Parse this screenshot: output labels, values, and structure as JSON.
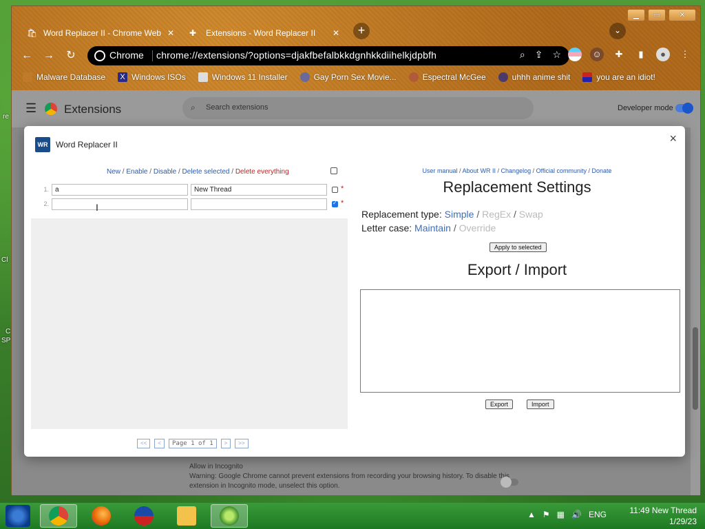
{
  "desktop": {
    "left_fragments": [
      "re",
      "Cl",
      "C",
      "SP"
    ]
  },
  "browser": {
    "tabs": [
      {
        "label": "Word Replacer II - Chrome Web",
        "icon": "webstore-icon"
      },
      {
        "label": "Extensions - Word Replacer II",
        "icon": "puzzle-icon"
      }
    ],
    "new_tab_symbol": "+",
    "omnibox": {
      "site_label": "Chrome",
      "url": "chrome://extensions/?options=djakfbefalbkkdgnhkkdiihelkjdpbfh"
    },
    "bookmarks": [
      {
        "label": "Malware Database",
        "icon": "folder-icon"
      },
      {
        "label": "Windows ISOs",
        "icon": "x-icon"
      },
      {
        "label": "Windows 11 Installer",
        "icon": "installer-icon"
      },
      {
        "label": "Gay Porn Sex Movie...",
        "icon": "site-icon"
      },
      {
        "label": "Espectral McGee",
        "icon": "face-icon"
      },
      {
        "label": "uhhh anime shit",
        "icon": "anime-icon"
      },
      {
        "label": "you are an idiot!",
        "icon": "flag-icon"
      }
    ]
  },
  "extensions_page": {
    "title": "Extensions",
    "search_placeholder": "Search extensions",
    "developer_mode_label": "Developer mode",
    "incognito_title": "Allow in Incognito",
    "incognito_warning": "Warning: Google Chrome cannot prevent extensions from recording your browsing history. To disable this extension in Incognito mode, unselect this option."
  },
  "dialog": {
    "icon_text": "WR",
    "title": "Word Replacer II",
    "close_symbol": "×",
    "actions": {
      "new": "New",
      "enable": "Enable",
      "disable": "Disable",
      "delete_selected": "Delete selected",
      "delete_everything": "Delete everything"
    },
    "rows": [
      {
        "num": "1.",
        "find": "a",
        "replace": "New Thread",
        "checked": false
      },
      {
        "num": "2.",
        "find": "",
        "replace": "",
        "checked": true
      }
    ],
    "required_mark": "*",
    "pager": {
      "first": "<<",
      "prev": "<",
      "label": "Page 1 of 1",
      "next": ">",
      "last": ">>"
    },
    "links": {
      "manual": "User manual",
      "about": "About WR II",
      "changelog": "Changelog",
      "community": "Official community",
      "donate": "Donate"
    },
    "settings_heading": "Replacement Settings",
    "replacement_type": {
      "label": "Replacement type:",
      "simple": "Simple",
      "regex": "RegEx",
      "swap": "Swap"
    },
    "letter_case": {
      "label": "Letter case:",
      "maintain": "Maintain",
      "override": "Override"
    },
    "apply_button": "Apply to selected",
    "export_heading": "Export / Import",
    "export_button": "Export",
    "import_button": "Import"
  },
  "taskbar": {
    "language": "ENG",
    "time": "11:49 New Thread",
    "date": "1/29/23"
  },
  "colors": {
    "accent_link": "#2b5aa8",
    "danger": "#c02020",
    "active_option": "#3a6ec0",
    "inactive_option": "#bbbbbb"
  }
}
